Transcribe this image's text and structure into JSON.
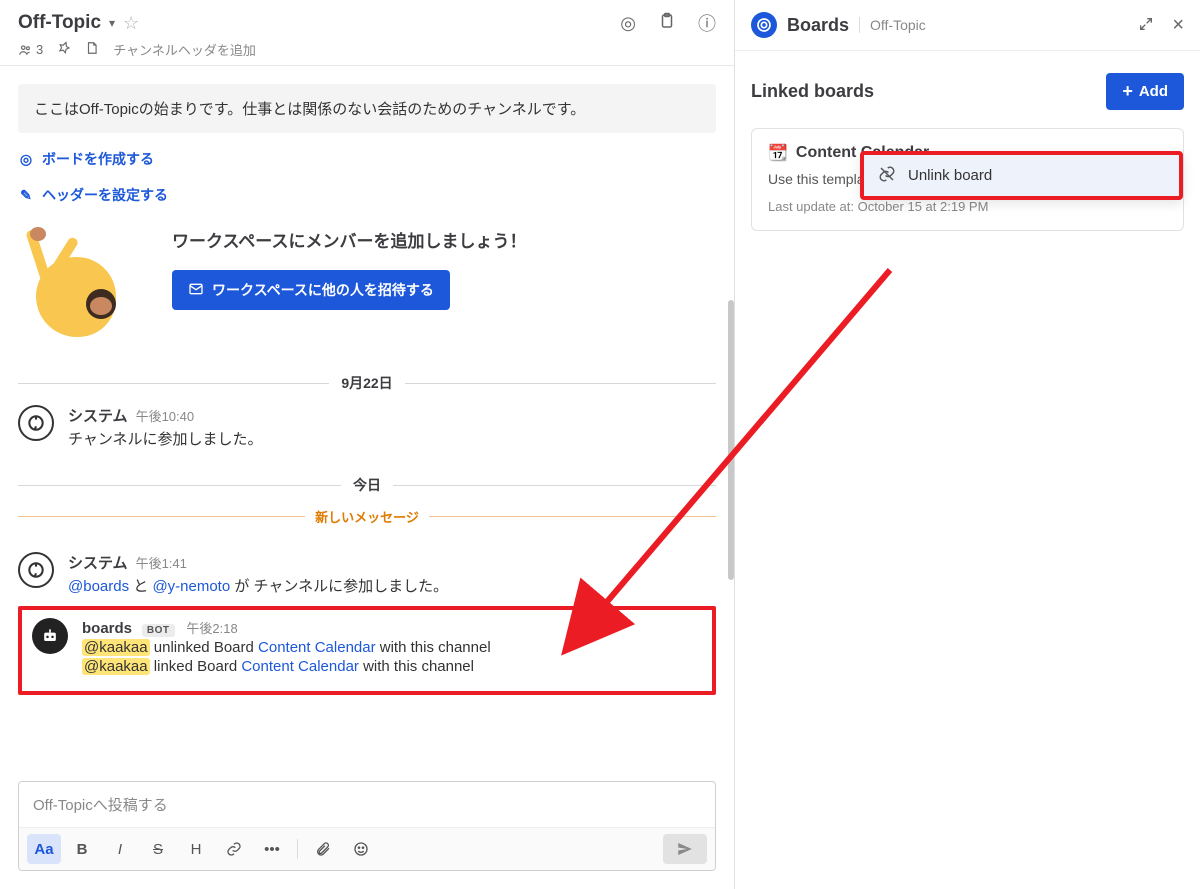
{
  "header": {
    "channelName": "Off-Topic",
    "memberCount": "3",
    "headingPlaceholder": "チャンネルヘッダを追加"
  },
  "intro": {
    "text": "ここはOff-Topicの始まりです。仕事とは関係のない会話のためのチャンネルです。",
    "createBoard": "ボードを作成する",
    "setHeader": "ヘッダーを設定する",
    "inviteTitle": "ワークスペースにメンバーを追加しましょう！",
    "inviteButton": "ワークスペースに他の人を招待する"
  },
  "separators": {
    "date1": "9月22日",
    "date2": "今日",
    "newMsg": "新しいメッセージ"
  },
  "posts": {
    "sys1": {
      "name": "システム",
      "time": "午後10:40",
      "text": "チャンネルに参加しました。"
    },
    "sys2": {
      "name": "システム",
      "time": "午後1:41",
      "m1": "@boards",
      "joiner": " と ",
      "m2": "@y-nemoto",
      "tail": " が チャンネルに参加しました。"
    },
    "bot": {
      "name": "boards",
      "badge": "BOT",
      "time": "午後2:18",
      "l1m": "@kaakaa",
      "l1a": " unlinked Board ",
      "l1b": "Content Calendar",
      "l1c": "  with this channel",
      "l2m": "@kaakaa",
      "l2a": " linked Board ",
      "l2b": "Content Calendar",
      "l2c": "  with this channel"
    }
  },
  "composer": {
    "placeholder": "Off-Topicへ投稿する",
    "aa": "Aa",
    "bold": "B",
    "italic": "I",
    "strike": "S",
    "heading": "H"
  },
  "sidebar": {
    "title": "Boards",
    "sub": "Off-Topic",
    "sectionTitle": "Linked boards",
    "addLabel": "Add",
    "card": {
      "emoji": "📆",
      "title": "Content Calendar",
      "desc": "Use this template to plan and organize your editorial content.",
      "meta": "Last update at: October 15 at 2:19 PM"
    },
    "menu": {
      "unlink": "Unlink board"
    }
  }
}
